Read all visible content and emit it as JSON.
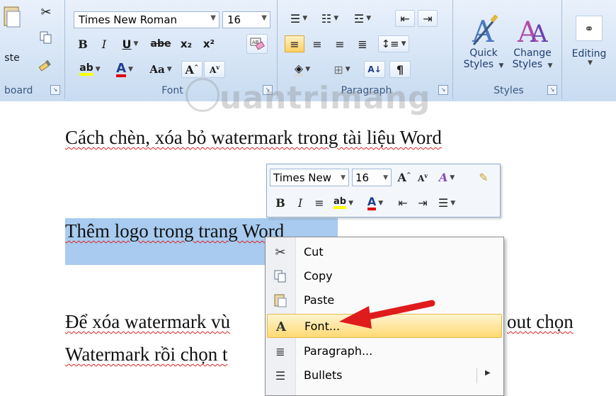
{
  "ribbon": {
    "clipboard": {
      "paste_label": "ste",
      "group_label": "board"
    },
    "font": {
      "font_name": "Times New Roman",
      "font_size": "16",
      "bold": "B",
      "italic": "I",
      "underline": "U",
      "strike": "abe",
      "subscript": "x₂",
      "superscript": "x²",
      "change_case": "Aa",
      "group_label": "Font"
    },
    "paragraph": {
      "group_label": "Paragraph",
      "show_marks": "¶"
    },
    "styles": {
      "quick_styles_line1": "Quick",
      "quick_styles_line2": "Styles",
      "change_styles_line1": "Change",
      "change_styles_line2": "Styles",
      "group_label": "Styles"
    },
    "editing": {
      "label": "Editing"
    }
  },
  "document": {
    "line1": "Cách chèn, xóa bỏ watermark  trong tài liệu Word",
    "line2": "Thêm logo trong trang Word",
    "line3_start": "Để xóa watermark  vù",
    "line3_end": "out chọn",
    "line4_start": "Watermark rồi chọn t"
  },
  "watermark": {
    "text": "uantrimang"
  },
  "mini_toolbar": {
    "font_name": "Times New",
    "font_size": "16",
    "bold": "B",
    "italic": "I"
  },
  "context_menu": {
    "items": [
      {
        "icon": "cut-icon",
        "label": "Cut"
      },
      {
        "icon": "copy-icon",
        "label": "Copy"
      },
      {
        "icon": "paste-icon",
        "label": "Paste"
      },
      {
        "icon": "font-icon",
        "label": "Font..."
      },
      {
        "icon": "paragraph-icon",
        "label": "Paragraph..."
      },
      {
        "icon": "bullets-icon",
        "label": "Bullets"
      }
    ]
  },
  "colors": {
    "highlight_yellow": "#ffff00",
    "font_color_red": "#e00000",
    "selection_blue": "#a8cbef",
    "arrow_red": "#e01b1b"
  }
}
